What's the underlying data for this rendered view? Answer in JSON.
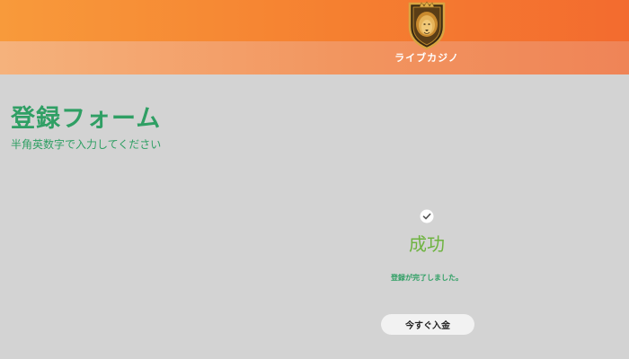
{
  "header": {
    "brand_name": "ライブカジノ",
    "logo_icon": "lion-shield-icon"
  },
  "form": {
    "title": "登録フォーム",
    "subtitle": "半角英数字で入力してください"
  },
  "result": {
    "icon": "check-circle-icon",
    "title": "成功",
    "message": "登録が完了しました。",
    "button_label": "今すぐ入金"
  },
  "colors": {
    "header_orange": "#f57f30",
    "header_band": "#f2955f",
    "background": "#d3d3d3",
    "title_green": "#2f9f64",
    "success_green": "#6db33f",
    "button_bg": "#f2f2f2"
  }
}
